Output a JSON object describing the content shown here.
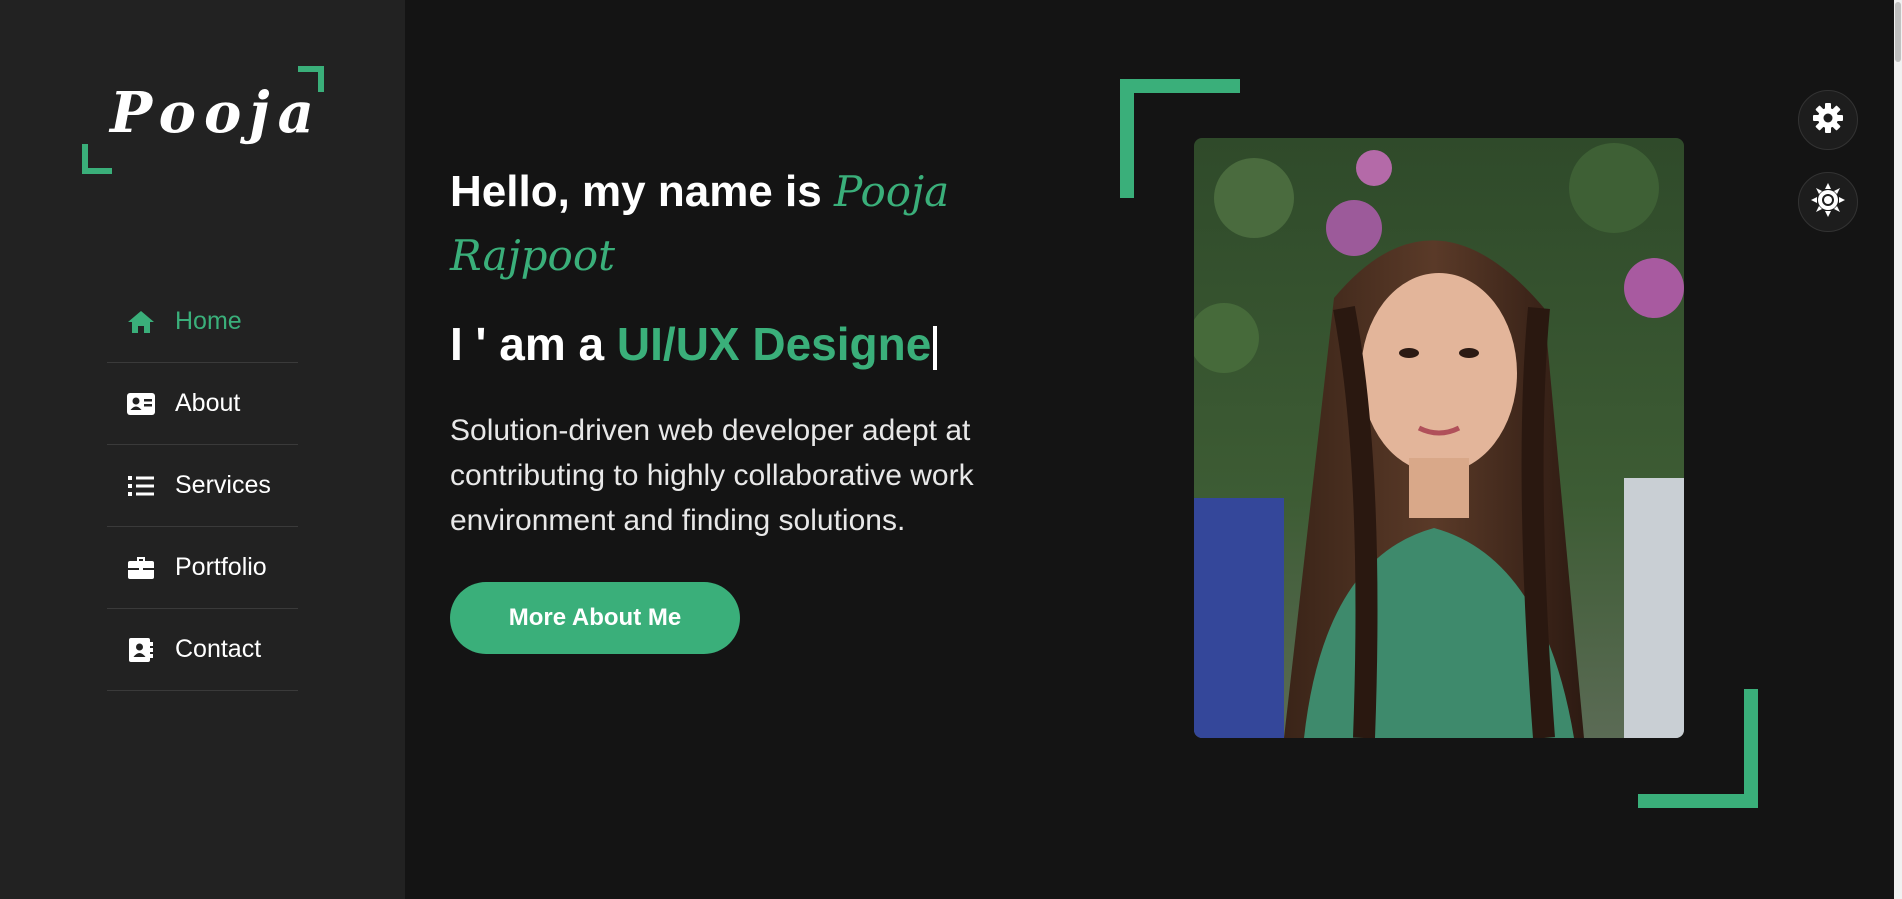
{
  "logo": {
    "text": "Pooja"
  },
  "nav": {
    "items": [
      {
        "label": "Home",
        "icon": "home-icon",
        "active": true
      },
      {
        "label": "About",
        "icon": "id-card-icon"
      },
      {
        "label": "Services",
        "icon": "list-icon"
      },
      {
        "label": "Portfolio",
        "icon": "briefcase-icon"
      },
      {
        "label": "Contact",
        "icon": "address-book-icon"
      }
    ]
  },
  "intro": {
    "greeting_prefix": "Hello, my name is",
    "name": "Pooja Rajpoot",
    "role_prefix": "I ' am a",
    "role_typed": "UI/UX Designe",
    "bio": "Solution-driven web developer adept at contributing to highly collaborative work environment and finding solutions."
  },
  "cta": {
    "label": "More About Me"
  },
  "controls": {
    "settings_icon": "gear-icon",
    "theme_icon": "sun-icon"
  },
  "colors": {
    "accent": "#3aaf7a",
    "background": "#141414",
    "sidebar": "#222222"
  }
}
